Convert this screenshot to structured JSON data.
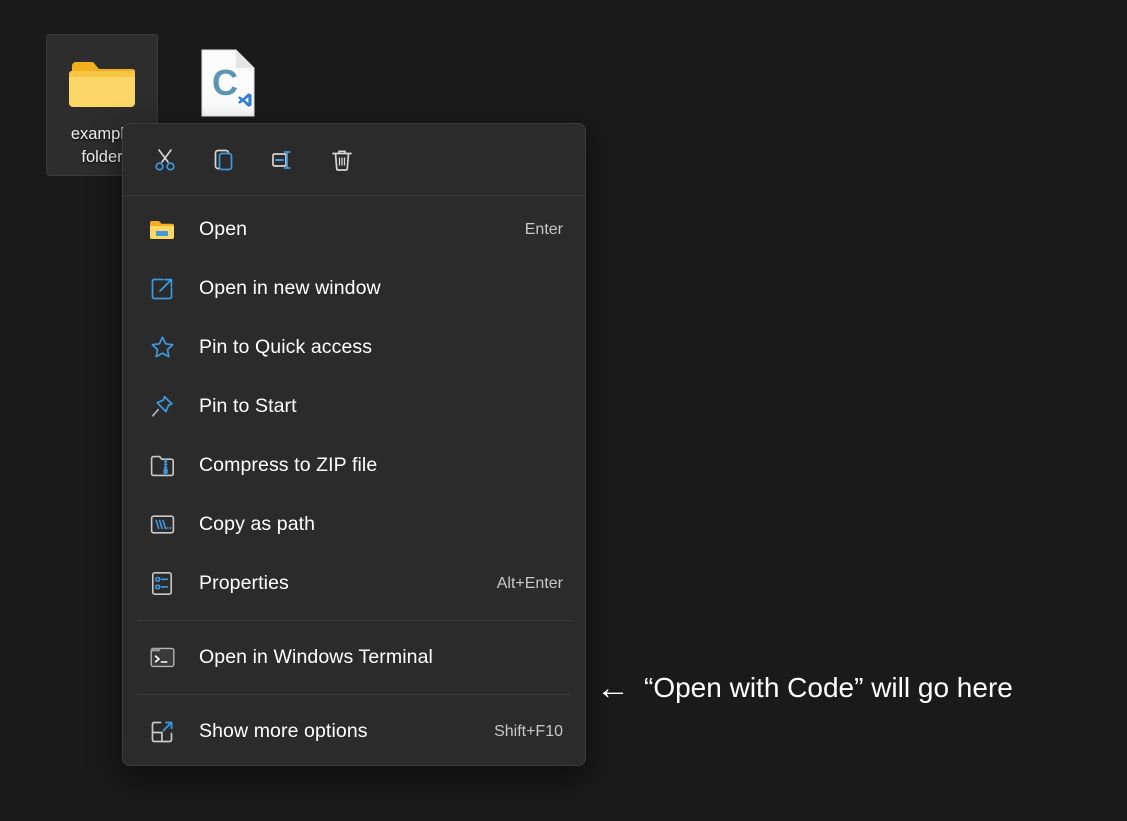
{
  "desktop": {
    "background_color": "#1a1a1a",
    "icons": [
      {
        "name": "example-folder",
        "label": "example folder",
        "icon": "folder-icon",
        "selected": true
      },
      {
        "name": "vscode-file",
        "label": "",
        "icon": "vscode-file-icon",
        "selected": false
      }
    ]
  },
  "context_menu": {
    "background_color": "#2b2b2b",
    "accent_color": "#3d9ae0",
    "toolbar": [
      {
        "name": "cut",
        "label": "Cut",
        "icon": "scissors-icon"
      },
      {
        "name": "copy",
        "label": "Copy",
        "icon": "copy-icon"
      },
      {
        "name": "rename",
        "label": "Rename",
        "icon": "rename-icon"
      },
      {
        "name": "delete",
        "label": "Delete",
        "icon": "trash-icon"
      }
    ],
    "groups": [
      {
        "items": [
          {
            "label": "Open",
            "shortcut": "Enter",
            "icon": "folder-open-icon"
          },
          {
            "label": "Open in new window",
            "shortcut": "",
            "icon": "open-new-window-icon"
          },
          {
            "label": "Pin to Quick access",
            "shortcut": "",
            "icon": "star-icon"
          },
          {
            "label": "Pin to Start",
            "shortcut": "",
            "icon": "pin-icon"
          },
          {
            "label": "Compress to ZIP file",
            "shortcut": "",
            "icon": "zip-folder-icon"
          },
          {
            "label": "Copy as path",
            "shortcut": "",
            "icon": "copy-path-icon"
          },
          {
            "label": "Properties",
            "shortcut": "Alt+Enter",
            "icon": "properties-icon"
          }
        ]
      },
      {
        "items": [
          {
            "label": "Open in Windows Terminal",
            "shortcut": "",
            "icon": "terminal-icon"
          }
        ]
      },
      {
        "items": [
          {
            "label": "Show more options",
            "shortcut": "Shift+F10",
            "icon": "show-more-icon"
          }
        ]
      }
    ]
  },
  "annotation": {
    "arrow": "←",
    "text": "“Open with Code” will go here"
  }
}
